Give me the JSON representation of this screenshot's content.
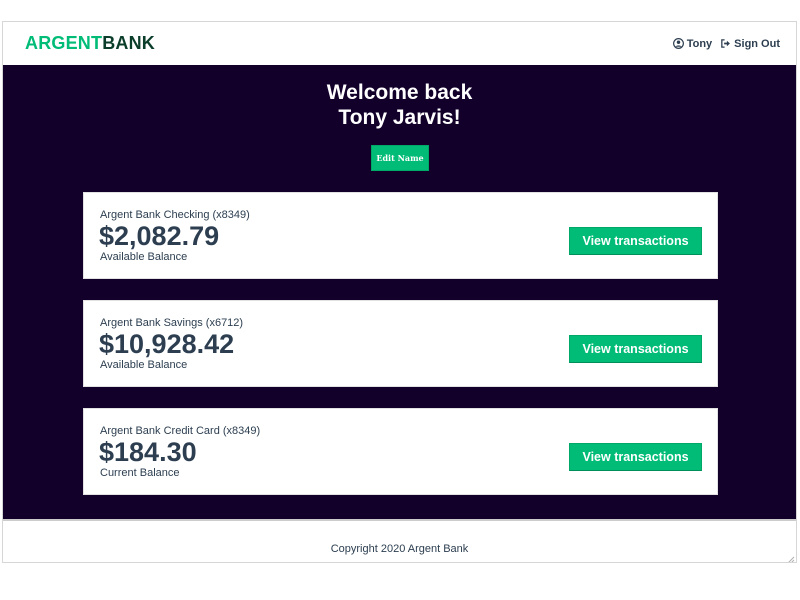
{
  "header": {
    "logo_argent": "ARGENT",
    "logo_bank": "BANK",
    "user_name": "Tony",
    "sign_out": "Sign Out",
    "icons": {
      "user": "user-circle-icon",
      "sign_out": "sign-out-icon"
    }
  },
  "welcome": {
    "line1": "Welcome back",
    "line2": "Tony Jarvis!",
    "edit_button": "Edit Name"
  },
  "accounts": [
    {
      "title": "Argent Bank Checking (x8349)",
      "amount": "$2,082.79",
      "description": "Available Balance",
      "button": "View transactions"
    },
    {
      "title": "Argent Bank Savings (x6712)",
      "amount": "$10,928.42",
      "description": "Available Balance",
      "button": "View transactions"
    },
    {
      "title": "Argent Bank Credit Card (x8349)",
      "amount": "$184.30",
      "description": "Current Balance",
      "button": "View transactions"
    }
  ],
  "footer": {
    "copyright": "Copyright 2020 Argent Bank"
  },
  "colors": {
    "brand_green": "#00bc77",
    "brand_dark_green": "#0a3d2a",
    "main_background": "#12002b",
    "text_dark": "#2c3e50"
  }
}
